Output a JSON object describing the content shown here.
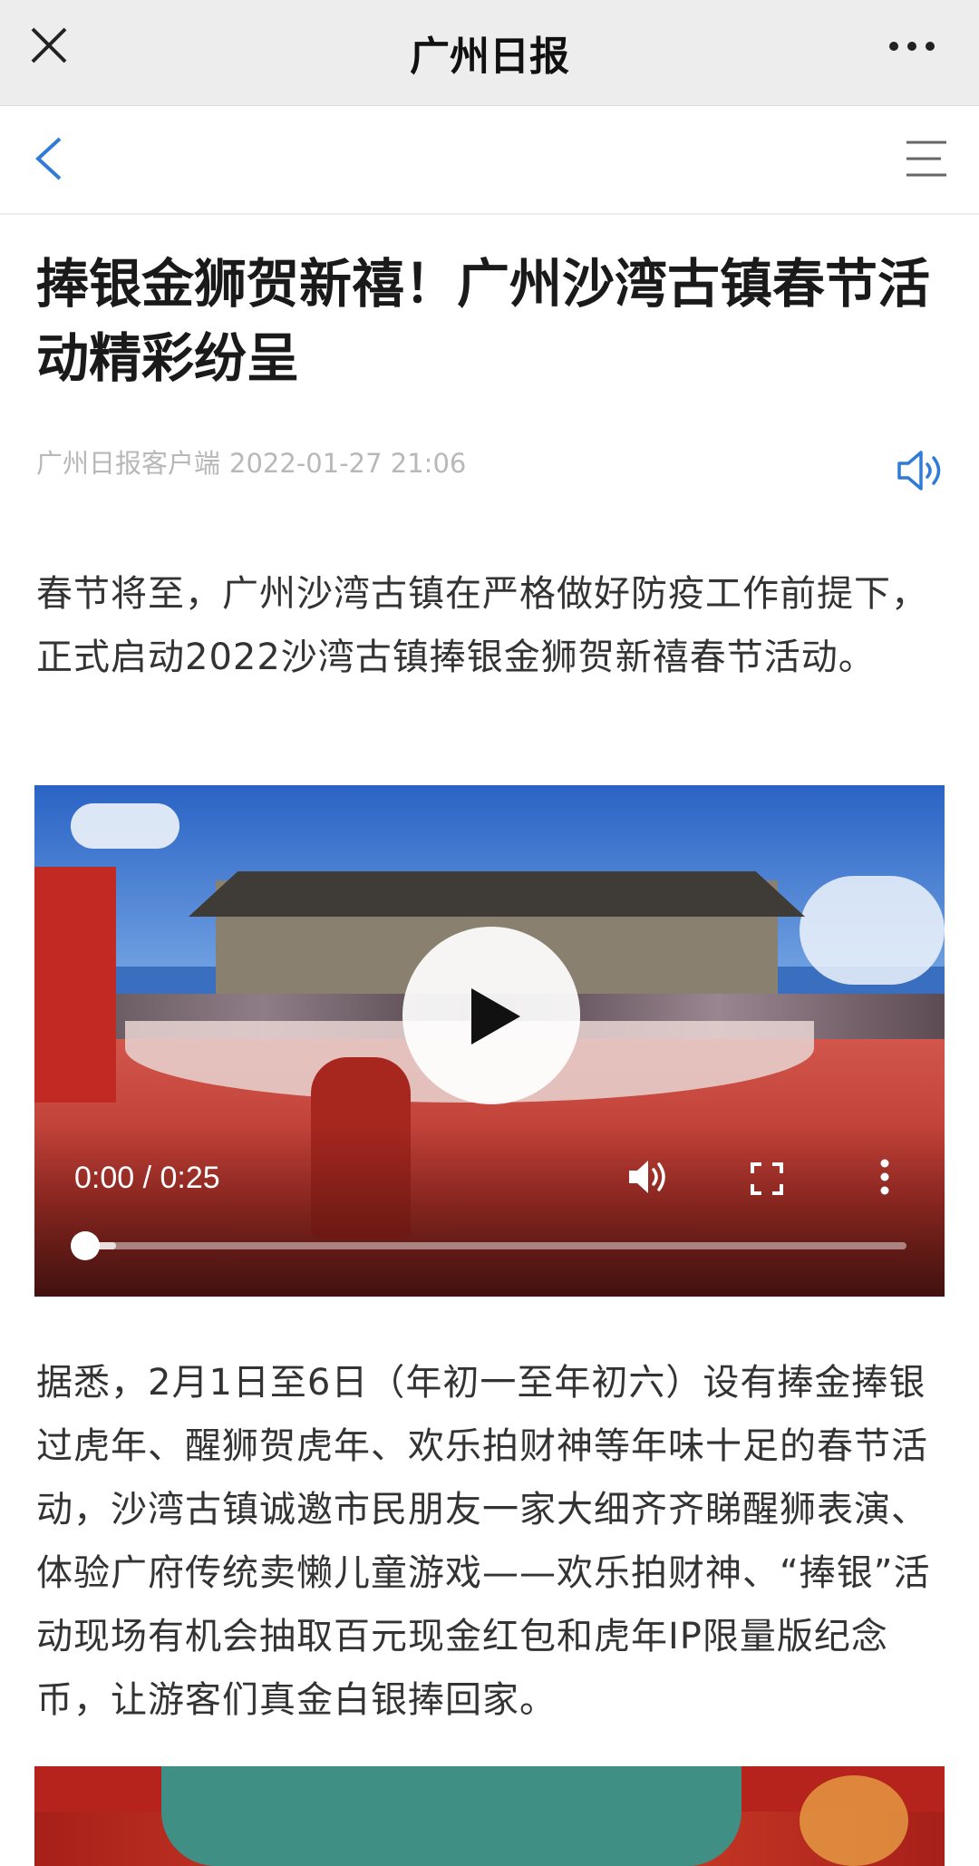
{
  "webview": {
    "title": "广州日报"
  },
  "article": {
    "headline": "捧银金狮贺新禧！广州沙湾古镇春节活动精彩纷呈",
    "source": "广州日报客户端",
    "datetime": "2022-01-27 21:06",
    "paragraph1": "春节将至，广州沙湾古镇在严格做好防疫工作前提下，正式启动2022沙湾古镇捧银金狮贺新禧春节活动。",
    "paragraph2": "据悉，2月1日至6日（年初一至年初六）设有捧金捧银过虎年、醒狮贺虎年、欢乐拍财神等年味十足的春节活动，沙湾古镇诚邀市民朋友一家大细齐齐睇醒狮表演、体验广府传统卖懒儿童游戏——欢乐拍财神、“捧银”活动现场有机会抽取百元现金红包和虎年IP限量版纪念币，让游客们真金白银捧回家。"
  },
  "video": {
    "time_display": "0:00 / 0:25",
    "progress": 0.0,
    "buffered": 0.05
  },
  "colors": {
    "accent": "#2f7bd6",
    "meta_text": "#b8b8b8",
    "topbar_bg": "#ededed"
  },
  "icons": {
    "close": "close-icon",
    "more": "more-dots-icon",
    "back": "chevron-left-icon",
    "menu": "hamburger-menu-icon",
    "audio": "speaker-icon",
    "play": "play-icon",
    "volume": "volume-icon",
    "fullscreen": "fullscreen-icon",
    "video_more": "kebab-menu-icon"
  }
}
